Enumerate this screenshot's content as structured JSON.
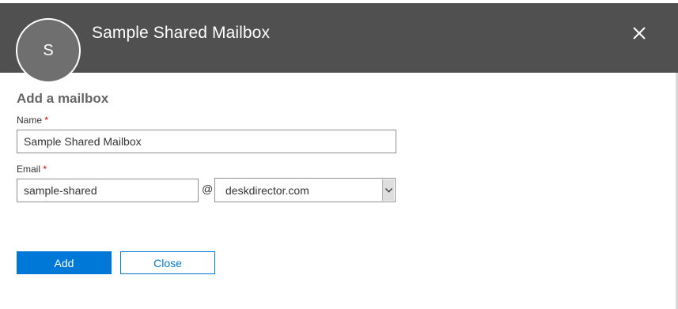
{
  "header": {
    "title": "Sample Shared Mailbox",
    "avatar_initial": "S",
    "close_icon": "close-icon"
  },
  "form": {
    "section_title": "Add a mailbox",
    "required_marker": "*",
    "name": {
      "label": "Name",
      "value": "Sample Shared Mailbox"
    },
    "email": {
      "label": "Email",
      "local_part": "sample-shared",
      "at_sign": "@",
      "domain_selected": "deskdirector.com"
    }
  },
  "actions": {
    "add_label": "Add",
    "close_label": "Close"
  },
  "colors": {
    "header_bg": "#505050",
    "accent": "#0078d7",
    "required": "#c80000"
  }
}
